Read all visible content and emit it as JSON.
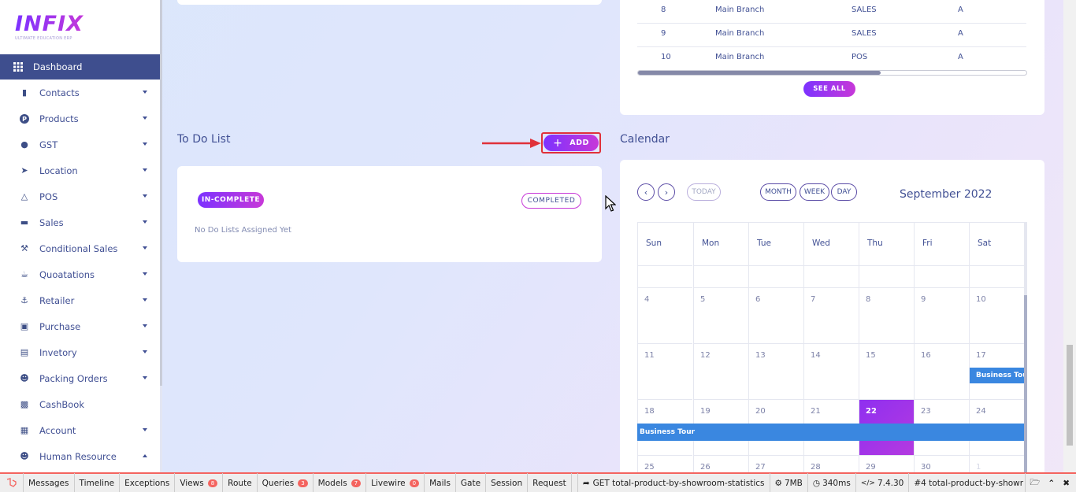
{
  "logo": {
    "main": "INFIX",
    "sub": "ULTIMATE EDUCATION ERP"
  },
  "sidebar": {
    "items": [
      {
        "label": "Dashboard",
        "icon": "grid-icon",
        "active": true
      },
      {
        "label": "Contacts",
        "icon": "contacts-icon"
      },
      {
        "label": "Products",
        "icon": "products-icon"
      },
      {
        "label": "GST",
        "icon": "gst-icon"
      },
      {
        "label": "Location",
        "icon": "location-icon"
      },
      {
        "label": "POS",
        "icon": "pos-icon"
      },
      {
        "label": "Sales",
        "icon": "sales-icon"
      },
      {
        "label": "Conditional Sales",
        "icon": "gavel-icon"
      },
      {
        "label": "Quoatations",
        "icon": "mug-icon"
      },
      {
        "label": "Retailer",
        "icon": "retailer-icon"
      },
      {
        "label": "Purchase",
        "icon": "store-icon"
      },
      {
        "label": "Invetory",
        "icon": "bank-icon"
      },
      {
        "label": "Packing Orders",
        "icon": "users-icon"
      },
      {
        "label": "CashBook",
        "icon": "book-icon"
      },
      {
        "label": "Account",
        "icon": "calculator-icon"
      },
      {
        "label": "Human Resource",
        "icon": "users-icon"
      }
    ]
  },
  "table": {
    "rows": [
      {
        "no": "8",
        "branch": "Main Branch",
        "type": "SALES",
        "status": "A"
      },
      {
        "no": "9",
        "branch": "Main Branch",
        "type": "SALES",
        "status": "A"
      },
      {
        "no": "10",
        "branch": "Main Branch",
        "type": "POS",
        "status": "A"
      }
    ],
    "see_all": "SEE ALL"
  },
  "todo": {
    "title": "To Do List",
    "add_label": "ADD",
    "incomplete_label": "IN-COMPLETE",
    "completed_label": "COMPLETED",
    "empty_text": "No Do Lists Assigned Yet"
  },
  "calendar": {
    "title": "Calendar",
    "today_label": "TODAY",
    "month_label": "MONTH",
    "week_label": "WEEK",
    "day_label": "DAY",
    "month_title": "September 2022",
    "weekdays": [
      "Sun",
      "Mon",
      "Tue",
      "Wed",
      "Thu",
      "Fri",
      "Sat"
    ],
    "weeks": [
      [
        "",
        "",
        "",
        "",
        "",
        "",
        ""
      ],
      [
        "4",
        "5",
        "6",
        "7",
        "8",
        "9",
        "10"
      ],
      [
        "11",
        "12",
        "13",
        "14",
        "15",
        "16",
        "17"
      ],
      [
        "18",
        "19",
        "20",
        "21",
        "22",
        "23",
        "24"
      ],
      [
        "25",
        "26",
        "27",
        "28",
        "29",
        "30",
        "1"
      ]
    ],
    "events": [
      "Business Tour",
      "Business Tour"
    ],
    "today_color": "#8f2ff0"
  },
  "debugbar": {
    "tabs": [
      {
        "label": "Messages"
      },
      {
        "label": "Timeline"
      },
      {
        "label": "Exceptions"
      },
      {
        "label": "Views",
        "count": "8"
      },
      {
        "label": "Route"
      },
      {
        "label": "Queries",
        "count": "3"
      },
      {
        "label": "Models",
        "count": "7"
      },
      {
        "label": "Livewire",
        "count": "0"
      },
      {
        "label": "Mails"
      },
      {
        "label": "Gate"
      },
      {
        "label": "Session"
      },
      {
        "label": "Request"
      }
    ],
    "request": "GET total-product-by-showroom-statistics",
    "memory": "7MB",
    "time": "340ms",
    "php": "7.4.30",
    "select": "#4 total-product-by-showr"
  }
}
